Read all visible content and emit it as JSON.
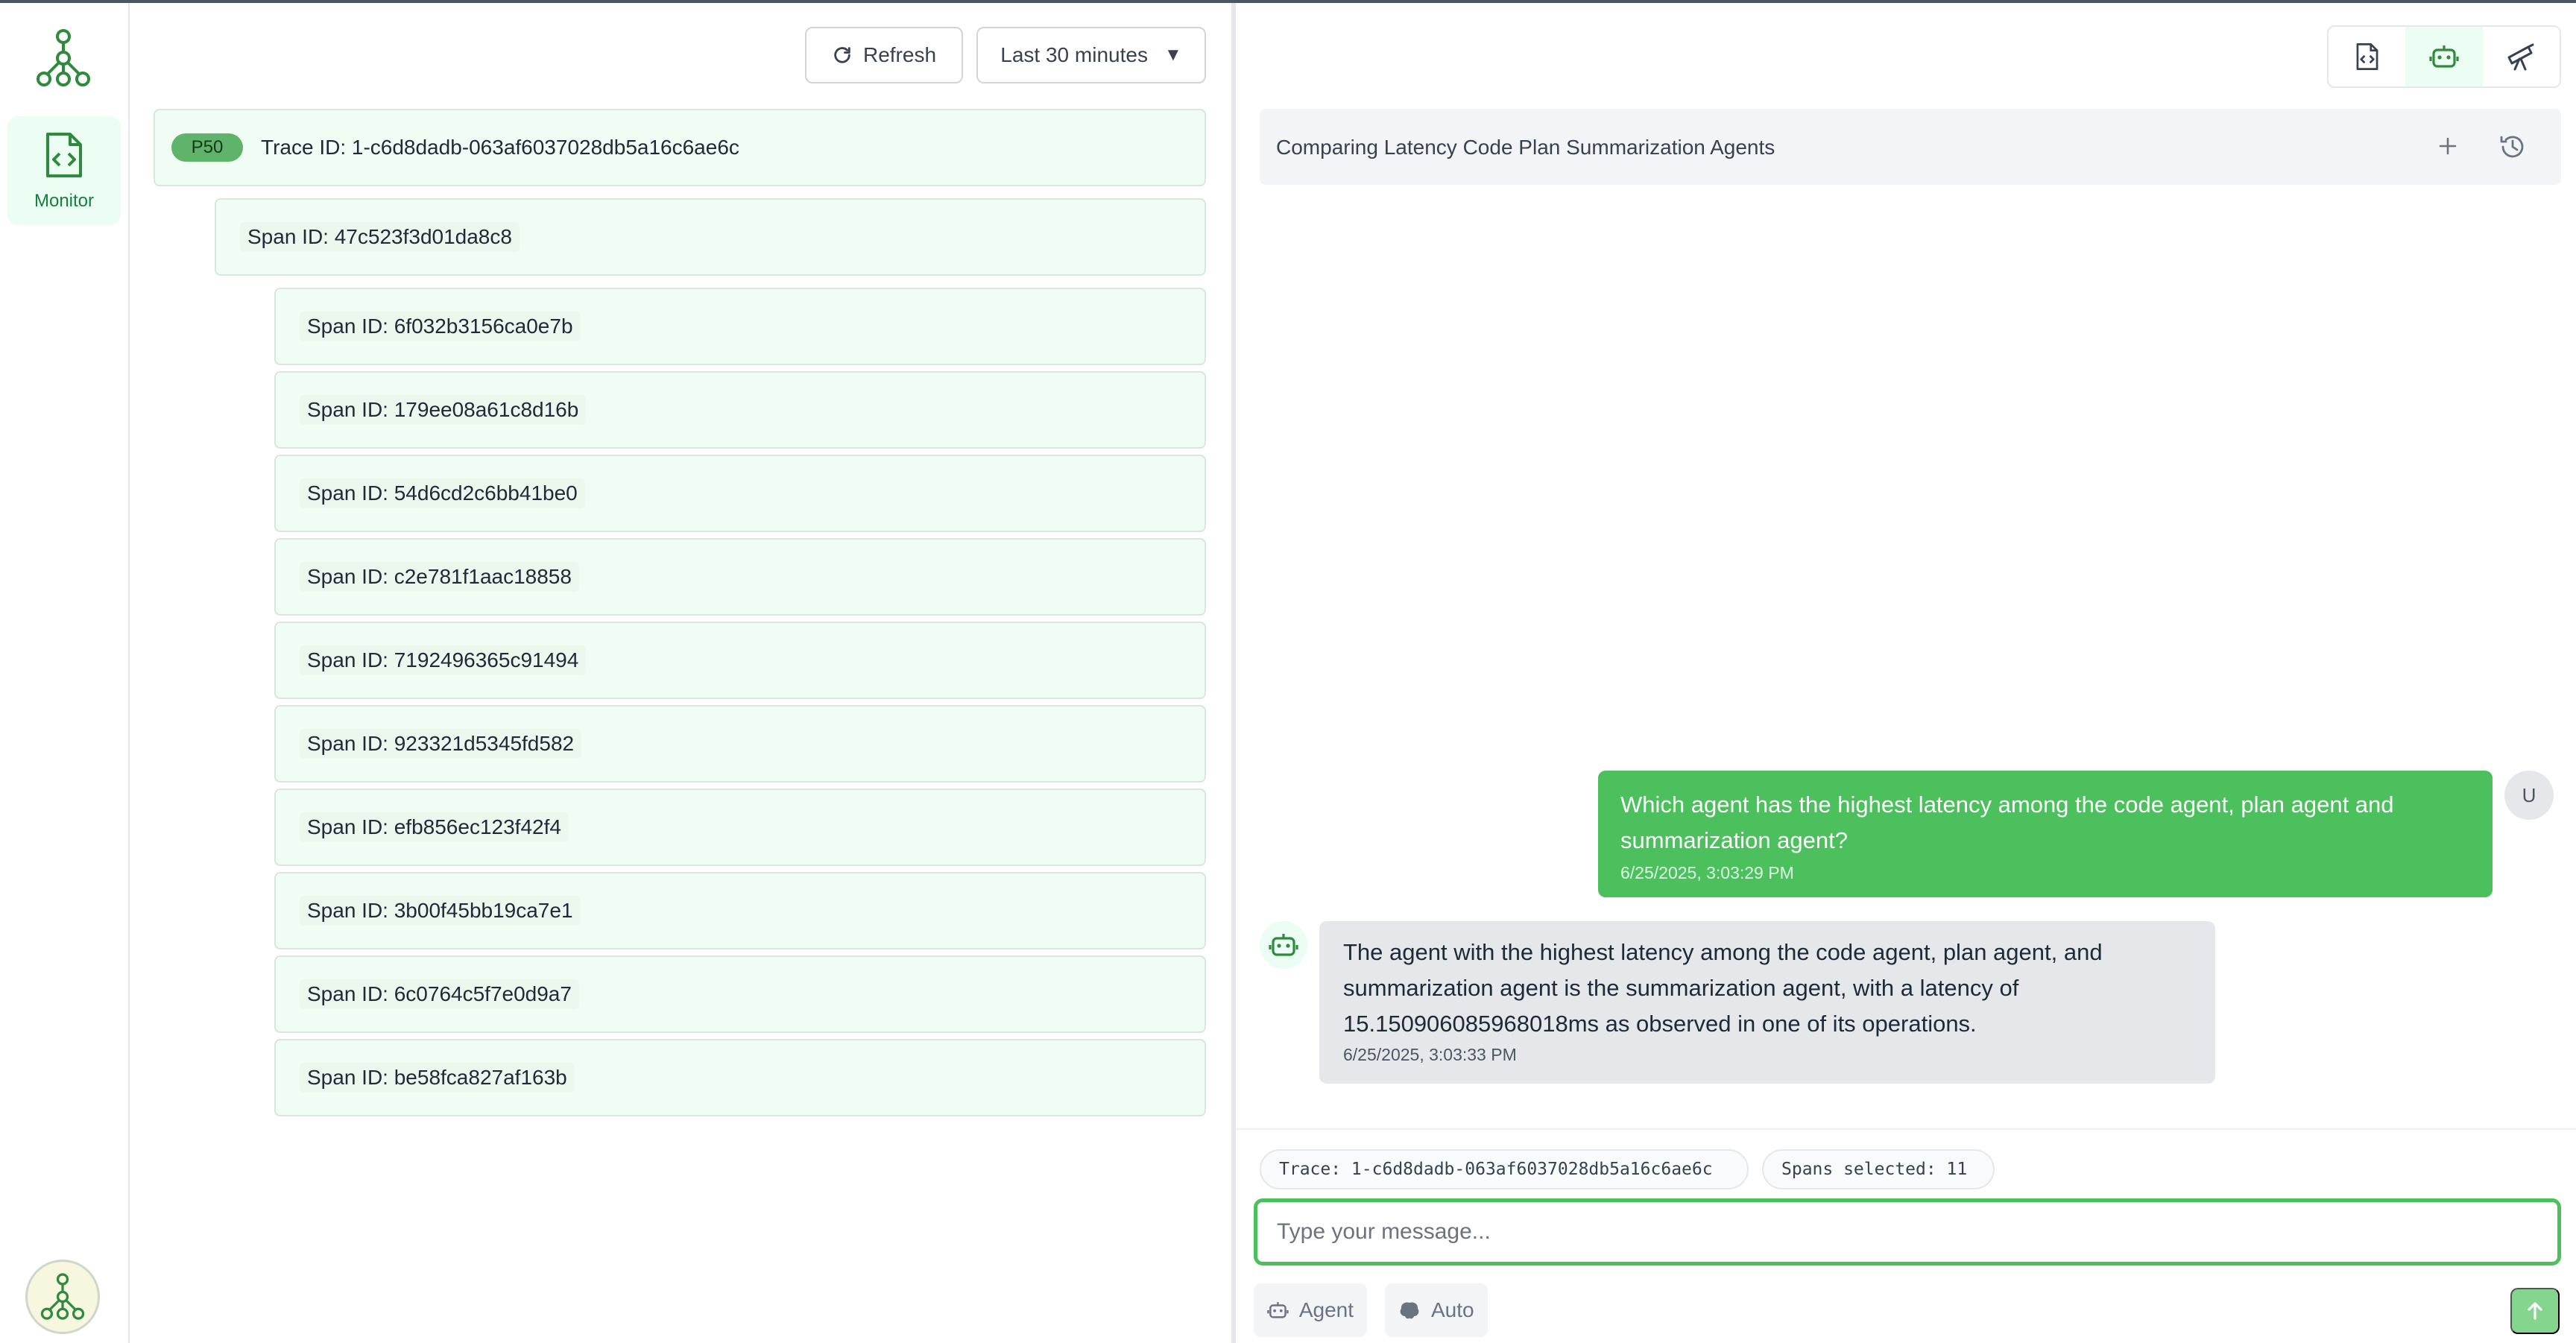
{
  "nav": {
    "logo_icon": "network-logo-icon",
    "monitor_label": "Monitor",
    "monitor_icon": "code-file-icon",
    "avatar_icon": "network-logo-icon"
  },
  "trace_panel": {
    "refresh_label": "Refresh",
    "time_range": "Last 30 minutes",
    "trace": {
      "badge": "P50",
      "label": "Trace ID: 1-c6d8dadb-063af6037028db5a16c6ae6c"
    },
    "root_span": "Span ID: 47c523f3d01da8c8",
    "child_spans": [
      "Span ID: 6f032b3156ca0e7b",
      "Span ID: 179ee08a61c8d16b",
      "Span ID: 54d6cd2c6bb41be0",
      "Span ID: c2e781f1aac18858",
      "Span ID: 7192496365c91494",
      "Span ID: 923321d5345fd582",
      "Span ID: efb856ec123f42f4",
      "Span ID: 3b00f45bb19ca7e1",
      "Span ID: 6c0764c5f7e0d9a7",
      "Span ID: be58fca827af163b"
    ]
  },
  "chat": {
    "toolbar_icons": [
      "code-file-icon",
      "robot-icon",
      "telescope-icon"
    ],
    "conversation_title": "Comparing Latency Code Plan Summarization Agents",
    "messages": {
      "user": {
        "avatar": "U",
        "text": "Which agent has the highest latency among the code agent, plan agent and summarization agent?",
        "time": "6/25/2025, 3:03:29 PM"
      },
      "bot": {
        "text": "The agent with the highest latency among the code agent, plan agent, and summarization agent is the summarization agent, with a latency of 15.150906085968018ms as observed in one of its operations.",
        "time": "6/25/2025, 3:03:33 PM"
      }
    },
    "context_trace": "Trace: 1-c6d8dadb-063af6037028db5a16c6ae6c",
    "context_spans": "Spans selected: 11",
    "input_placeholder": "Type your message...",
    "mode_agent": "Agent",
    "mode_auto": "Auto"
  },
  "colors": {
    "accent": "#4cc05d",
    "row_bg": "#f0fdf4",
    "badge": "#5fb36a"
  }
}
